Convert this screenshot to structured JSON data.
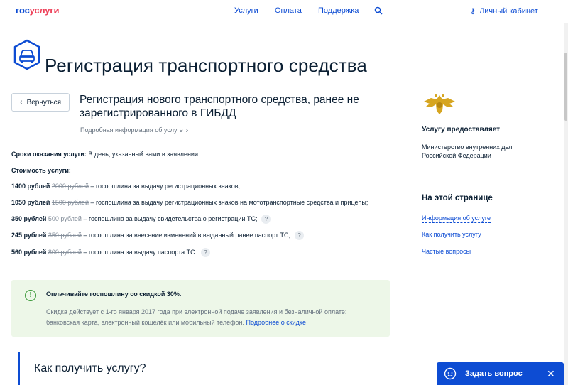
{
  "header": {
    "logo_part1": "гос",
    "logo_part2": "услуги",
    "nav": [
      "Услуги",
      "Оплата",
      "Поддержка"
    ],
    "account": "Личный кабинет",
    "colors": {
      "primary": "#0d4cd3",
      "logo_red": "#ee3f58"
    }
  },
  "page_title": "Регистрация транспортного средства",
  "back_button": "Вернуться",
  "service": {
    "title": "Регистрация нового транспортного средства, ранее не зарегистрированного в ГИБДД",
    "more_info": "Подробная информация об услуге"
  },
  "terms": {
    "label": "Сроки оказания услуги:",
    "value": " В день, указанный вами в заявлении."
  },
  "cost_label": "Стоимость услуги:",
  "fees": [
    {
      "price": "1400 рублей",
      "old": "2000 рублей",
      "desc": " – госпошлина за выдачу регистрационных знаков;"
    },
    {
      "price": "1050 рублей",
      "old": "1500 рублей",
      "desc": " – госпошлина за выдачу регистрационных знаков на мототранспортные средства и прицепы;"
    },
    {
      "price": "350 рублей",
      "old": "500 рублей",
      "desc": " – госпошлина за выдачу свидетельства о регистрации ТС;"
    },
    {
      "price": "245 рублей",
      "old": "350 рублей",
      "desc": " – госпошлина за внесение изменений в выданный ранее паспорт ТС;"
    },
    {
      "price": "560 рублей",
      "old": "800 рублей",
      "desc": " – госпошлина за выдачу паспорта ТС."
    }
  ],
  "help_mark": "?",
  "notice": {
    "icon_glyph": "!",
    "title": "Оплачивайте госпошлину со скидкой 30%.",
    "body": "Скидка действует с 1-го января 2017 года при электронной подаче заявления и безналичной оплате: банковская карта, электронный кошелёк или мобильный телефон. ",
    "link": "Подробнее о скидке",
    "color": "#edf7e8"
  },
  "howto_title": "Как получить услугу?",
  "provider": {
    "heading": "Услугу предоставляет",
    "name": "Министерство внутренних дел Российской Федерации"
  },
  "on_page": {
    "heading": "На этой странице",
    "links": [
      "Информация об услуге",
      "Как получить услугу",
      "Частые вопросы"
    ]
  },
  "chat": {
    "label": "Задать вопрос",
    "close": "✕"
  }
}
